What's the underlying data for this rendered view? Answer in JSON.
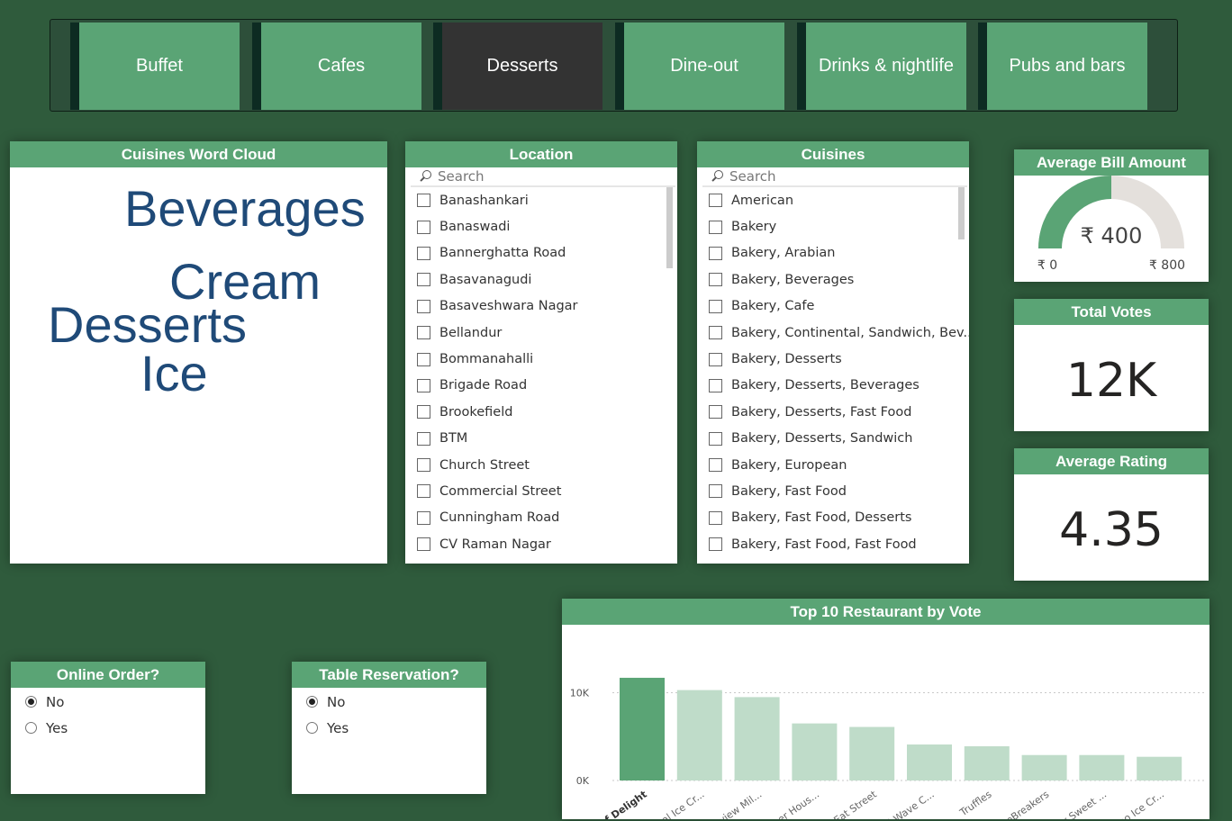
{
  "tabs": [
    {
      "label": "Buffet",
      "active": false
    },
    {
      "label": "Cafes",
      "active": false
    },
    {
      "label": "Desserts",
      "active": true
    },
    {
      "label": "Dine-out",
      "active": false
    },
    {
      "label": "Drinks & nightlife",
      "active": false
    },
    {
      "label": "Pubs and bars",
      "active": false
    }
  ],
  "word_cloud": {
    "title": "Cuisines Word Cloud",
    "words": [
      "Beverages",
      "Cream",
      "Desserts",
      "Ice"
    ]
  },
  "location": {
    "title": "Location",
    "search_placeholder": "Search",
    "items": [
      "Banashankari",
      "Banaswadi",
      "Bannerghatta Road",
      "Basavanagudi",
      "Basaveshwara Nagar",
      "Bellandur",
      "Bommanahalli",
      "Brigade Road",
      "Brookefield",
      "BTM",
      "Church Street",
      "Commercial Street",
      "Cunningham Road",
      "CV Raman Nagar"
    ]
  },
  "cuisines": {
    "title": "Cuisines",
    "search_placeholder": "Search",
    "items": [
      "American",
      "Bakery",
      "Bakery, Arabian",
      "Bakery, Beverages",
      "Bakery, Cafe",
      "Bakery, Continental, Sandwich, Bev...",
      "Bakery, Desserts",
      "Bakery, Desserts, Beverages",
      "Bakery, Desserts, Fast Food",
      "Bakery, Desserts, Sandwich",
      "Bakery, European",
      "Bakery, Fast Food",
      "Bakery, Fast Food, Desserts",
      "Bakery, Fast Food, Fast Food"
    ]
  },
  "avg_bill": {
    "title": "Average Bill Amount",
    "value_label": "₹ 400",
    "min_label": "₹ 0",
    "max_label": "₹ 800",
    "value": 400,
    "min": 0,
    "max": 800,
    "fill_color": "#5aa475",
    "track_color": "#e4e0dc"
  },
  "total_votes": {
    "title": "Total Votes",
    "value": "12K"
  },
  "avg_rating": {
    "title": "Average Rating",
    "value": "4.35"
  },
  "online_order": {
    "title": "Online Order?",
    "options": [
      {
        "label": "No",
        "selected": true
      },
      {
        "label": "Yes",
        "selected": false
      }
    ]
  },
  "table_reservation": {
    "title": "Table Reservation?",
    "options": [
      {
        "label": "No",
        "selected": true
      },
      {
        "label": "Yes",
        "selected": false
      }
    ]
  },
  "chart_data": {
    "type": "bar",
    "title": "Top 10 Restaurant by Vote",
    "categories": [
      "Art of Delight",
      "Natural Ice Cr...",
      "Lakeview Mil...",
      "Corner Hous...",
      "Eat Street",
      "Third Wave C...",
      "Truffles",
      "IceBreakers",
      "Kesar Sweet ...",
      "Milano Ice Cr..."
    ],
    "values": [
      11700,
      10300,
      9500,
      6500,
      6100,
      4100,
      3900,
      2900,
      2900,
      2700
    ],
    "yticks": [
      {
        "label": "0K",
        "value": 0
      },
      {
        "label": "10K",
        "value": 10000
      }
    ],
    "ylim": [
      0,
      12000
    ],
    "highlight_index": 0,
    "highlight_color": "#5aa475",
    "bar_color": "#bfdcc9",
    "grid": true
  }
}
